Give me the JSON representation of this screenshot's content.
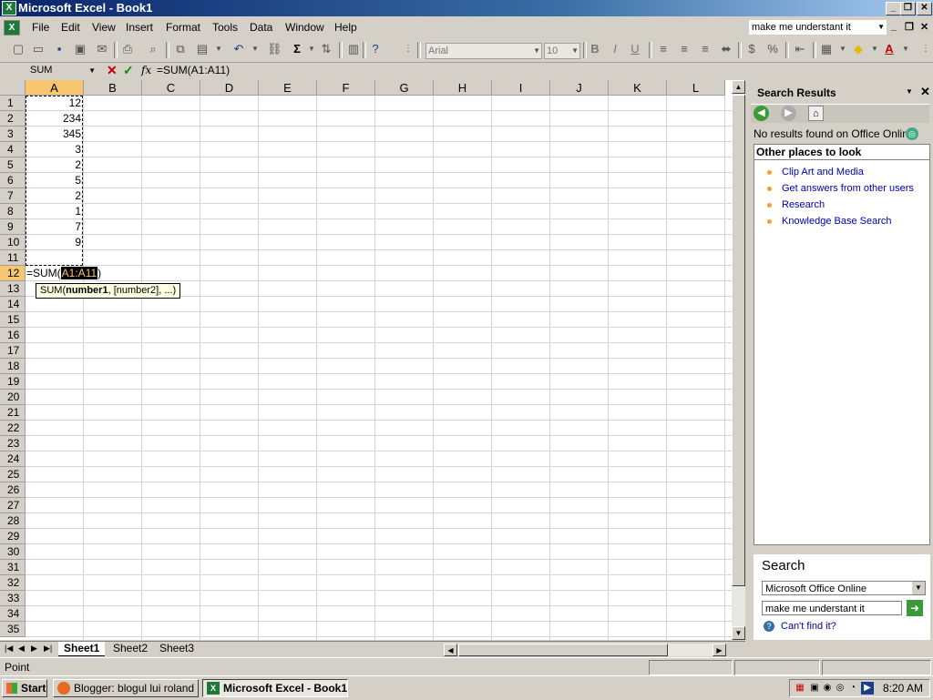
{
  "window": {
    "title": "Microsoft Excel - Book1"
  },
  "menu": [
    "File",
    "Edit",
    "View",
    "Insert",
    "Format",
    "Tools",
    "Data",
    "Window",
    "Help"
  ],
  "help_box": {
    "value": "make me understant it"
  },
  "toolbar": {
    "font": "Arial",
    "size": "10",
    "currency": "$",
    "percent": "%",
    "sigma": "Σ"
  },
  "formula_bar": {
    "name_box": "SUM",
    "fx": "fx",
    "formula": "=SUM(A1:A11)"
  },
  "columns": [
    "A",
    "B",
    "C",
    "D",
    "E",
    "F",
    "G",
    "H",
    "I",
    "J",
    "K",
    "L"
  ],
  "rows": [
    "1",
    "2",
    "3",
    "4",
    "5",
    "6",
    "7",
    "8",
    "9",
    "10",
    "11",
    "12",
    "13",
    "14",
    "15",
    "16",
    "17",
    "18",
    "19",
    "20",
    "21",
    "22",
    "23",
    "24",
    "25",
    "26",
    "27",
    "28",
    "29",
    "30",
    "31",
    "32",
    "33",
    "34",
    "35"
  ],
  "cells_a": [
    "12",
    "234",
    "345",
    "3",
    "2",
    "5",
    "2",
    "1",
    "7",
    "9"
  ],
  "edit_cell": {
    "prefix": "=SUM(",
    "ref": "A1:A11",
    "suffix": ")"
  },
  "tooltip": {
    "fn": "SUM(",
    "arg": "number1",
    "rest": ", [number2], ...)"
  },
  "sheets": [
    "Sheet1",
    "Sheet2",
    "Sheet3"
  ],
  "task_pane": {
    "title": "Search Results",
    "no_results": "No results found on Office Online",
    "other_places": "Other places to look",
    "links": [
      "Clip Art and Media",
      "Get answers from other users",
      "Research",
      "Knowledge Base Search"
    ],
    "search_heading": "Search",
    "search_scope": "Microsoft Office Online",
    "search_query": "make me understant it",
    "cant_find": "Can't find it?"
  },
  "status": {
    "mode": "Point"
  },
  "taskbar": {
    "start": "Start",
    "tasks": [
      "Blogger: blogul lui roland ...",
      "Microsoft Excel - Book1"
    ],
    "clock": "8:20 AM"
  }
}
